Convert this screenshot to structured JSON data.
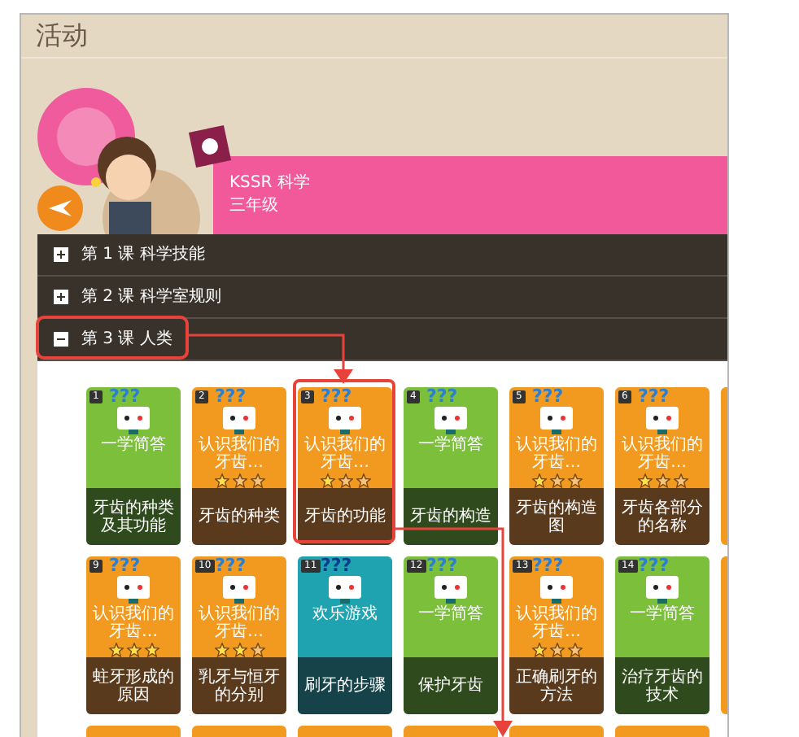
{
  "header": {
    "title": "活动"
  },
  "course": {
    "subject": "KSSR 科学",
    "grade": "三年级"
  },
  "units": [
    {
      "label": "第 1 课 科学技能",
      "expanded": false
    },
    {
      "label": "第 2 课 科学室规则",
      "expanded": false
    },
    {
      "label": "第 3 课 人类",
      "expanded": true
    }
  ],
  "cards": [
    {
      "number": "1",
      "kind": "quiz",
      "mark": "???",
      "title": "一学简答",
      "subtitle": "牙齿的种类及其功能"
    },
    {
      "number": "2",
      "kind": "lesson",
      "mark": "???",
      "title": "认识我们的牙齿…",
      "stars": 1,
      "subtitle": "牙齿的种类"
    },
    {
      "number": "3",
      "kind": "lesson",
      "mark": "???",
      "title": "认识我们的牙齿…",
      "stars": 1,
      "subtitle": "牙齿的功能"
    },
    {
      "number": "4",
      "kind": "quiz",
      "mark": "???",
      "title": "一学简答",
      "subtitle": "牙齿的构造"
    },
    {
      "number": "5",
      "kind": "lesson",
      "mark": "???",
      "title": "认识我们的牙齿…",
      "stars": 1,
      "subtitle": "牙齿的构造图"
    },
    {
      "number": "6",
      "kind": "lesson",
      "mark": "???",
      "title": "认识我们的牙齿…",
      "stars": 1,
      "subtitle": "牙齿各部分的名称"
    },
    {
      "number": "9",
      "kind": "lesson",
      "mark": "???",
      "title": "认识我们的牙齿…",
      "stars": 3,
      "subtitle": "蛀牙形成的原因"
    },
    {
      "number": "10",
      "kind": "lesson",
      "mark": "???",
      "title": "认识我们的牙齿…",
      "stars": 2,
      "subtitle": "乳牙与恒牙的分别"
    },
    {
      "number": "11",
      "kind": "game",
      "mark": "???",
      "title": "欢乐游戏",
      "subtitle": "刷牙的步骤"
    },
    {
      "number": "12",
      "kind": "quiz",
      "mark": "???",
      "title": "一学简答",
      "subtitle": "保护牙齿"
    },
    {
      "number": "13",
      "kind": "lesson",
      "mark": "???",
      "title": "认识我们的牙齿…",
      "stars": 1,
      "subtitle": "正确刷牙的方法"
    },
    {
      "number": "14",
      "kind": "quiz",
      "mark": "???",
      "title": "一学简答",
      "subtitle": "治疗牙齿的技术"
    }
  ]
}
